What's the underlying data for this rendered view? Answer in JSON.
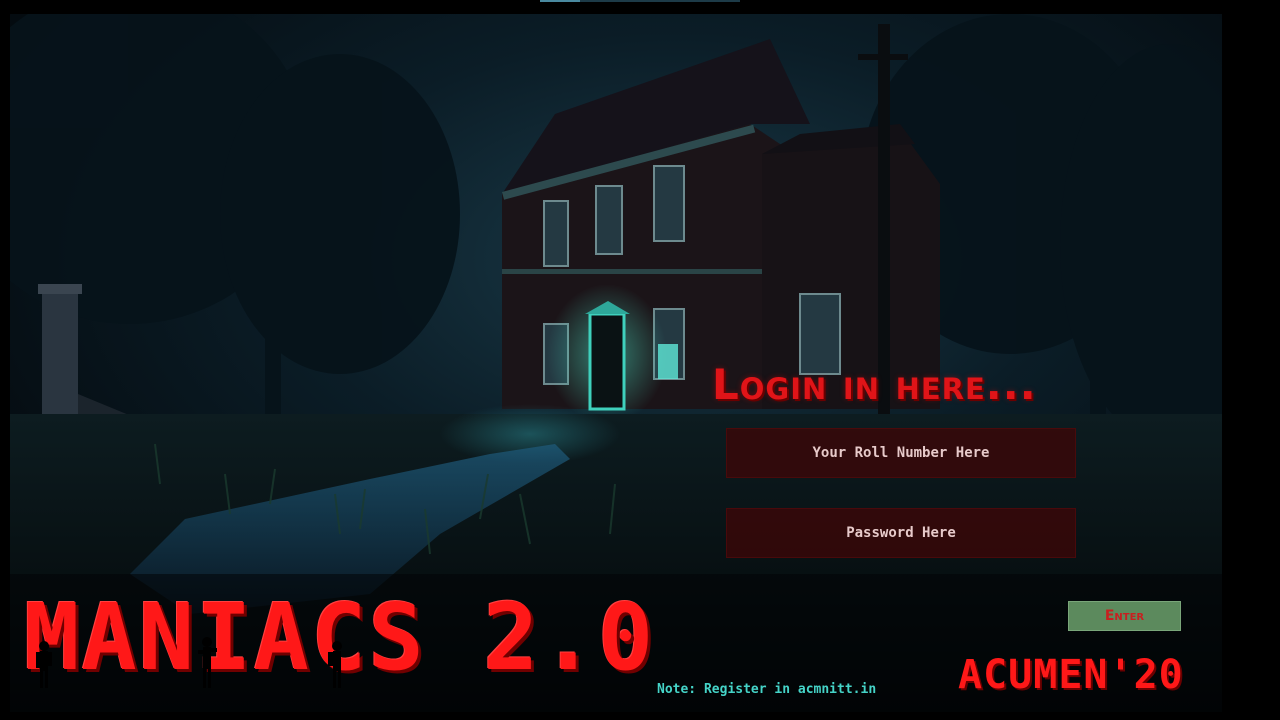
{
  "login": {
    "title": "Login in here...",
    "roll_placeholder": "Your Roll Number Here",
    "password_placeholder": "Password Here",
    "enter_label": "Enter"
  },
  "branding": {
    "game_title": "MANIACS 2.0",
    "event_name": "ACUMEN'20"
  },
  "footer": {
    "note": "Note: Register in acmnitt.in"
  },
  "colors": {
    "title_red": "#e01418",
    "field_bg": "#3c0608",
    "enter_bg": "#5c8a5d",
    "note_teal": "#45d4c8"
  },
  "scene": {
    "description_icon": "haunted-house-background"
  }
}
